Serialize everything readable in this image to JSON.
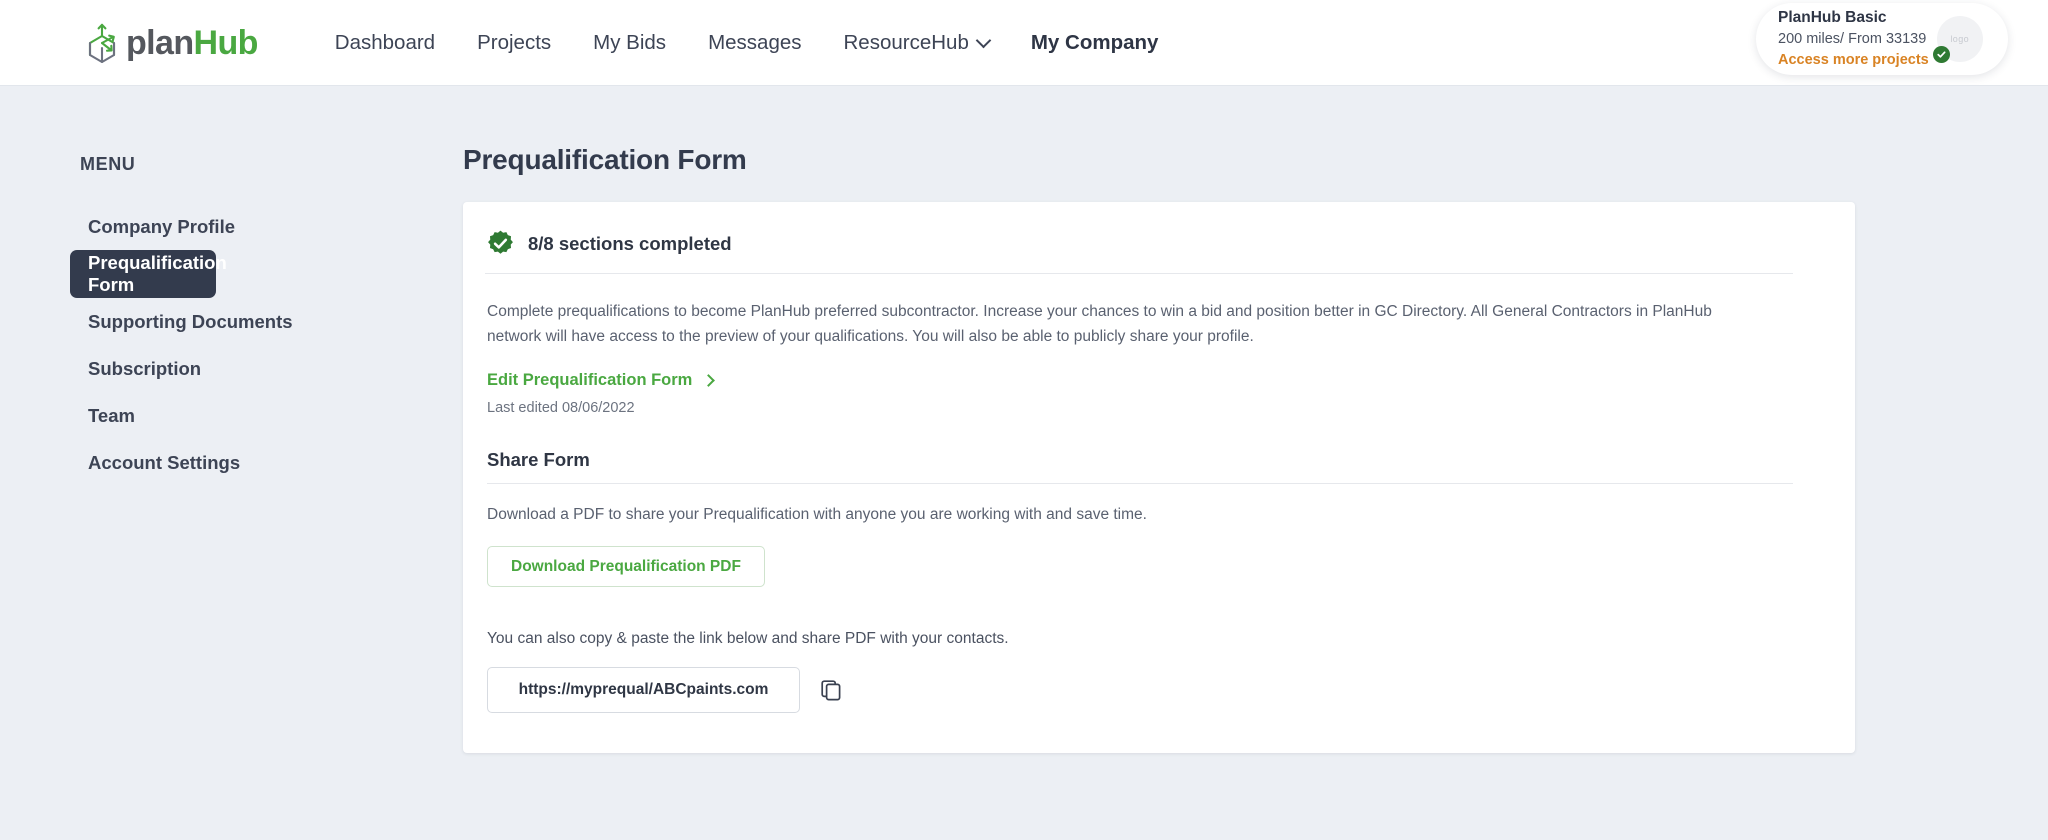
{
  "brand": {
    "logo_icon": "planhub-cube-arrows-icon",
    "name_part1": "plan",
    "name_part2": "Hub",
    "green": "#4aa841",
    "navy": "#333b4d",
    "orange": "#d98324"
  },
  "nav": {
    "items": [
      {
        "label": "Dashboard",
        "active": false,
        "has_chevron": false
      },
      {
        "label": "Projects",
        "active": false,
        "has_chevron": false
      },
      {
        "label": "My Bids",
        "active": false,
        "has_chevron": false
      },
      {
        "label": "Messages",
        "active": false,
        "has_chevron": false
      },
      {
        "label": "ResourceHub",
        "active": false,
        "has_chevron": true
      },
      {
        "label": "My Company",
        "active": true,
        "has_chevron": false
      }
    ]
  },
  "plan_badge": {
    "title": "PlanHub Basic",
    "subtitle": "200 miles/ From 33139",
    "cta": "Access more projects",
    "avatar_text": "logo",
    "verified_icon": "verified-check-icon"
  },
  "sidebar": {
    "label": "MENU",
    "items": [
      {
        "label": "Company Profile",
        "active": false
      },
      {
        "label": "Prequalification Form",
        "active": true
      },
      {
        "label": "Supporting Documents",
        "active": false
      },
      {
        "label": "Subscription",
        "active": false
      },
      {
        "label": "Team",
        "active": false
      },
      {
        "label": "Account Settings",
        "active": false
      }
    ]
  },
  "main": {
    "page_title": "Prequalification Form",
    "status": {
      "icon": "verified-seal-icon",
      "text": "8/8 sections completed"
    },
    "description": "Complete prequalifications to become PlanHub preferred subcontractor. Increase your chances to win a bid and position better in GC Directory. All General Contractors in PlanHub network will have access to the preview of your qualifications. You will also be able to publicly share your profile.",
    "edit_link": "Edit Prequalification Form",
    "last_edited": "Last edited 08/06/2022",
    "share_section": {
      "heading": "Share Form",
      "download_copy": "Download a PDF to share your Prequalification with anyone you are working with and save time.",
      "download_button": "Download Prequalification PDF",
      "copy_copy": "You can also copy & paste the link below and share PDF with your contacts.",
      "link_value": "https://myprequal/ABCpaints.com",
      "copy_icon": "copy-icon"
    }
  }
}
